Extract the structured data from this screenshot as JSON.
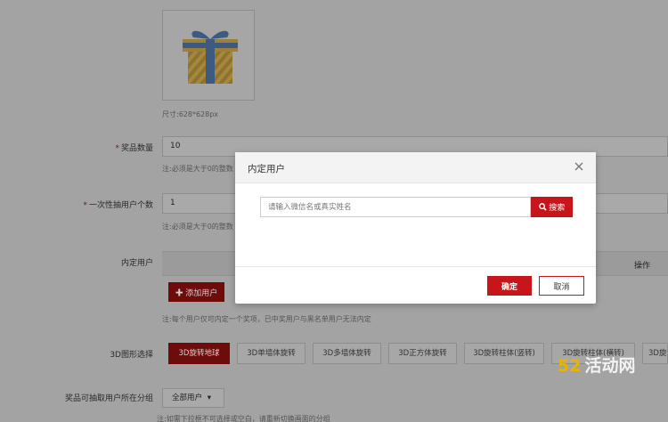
{
  "form": {
    "image_hint": "尺寸:628*628px",
    "prize_count": {
      "label": "奖品数量",
      "value": "10",
      "hint": "注:必须是大于0的整数"
    },
    "once_users": {
      "label": "一次性抽用户个数",
      "value": "1",
      "hint": "注:必须是大于0的整数"
    },
    "internal_users": {
      "label": "内定用户",
      "column_operation": "操作",
      "add_button": "添加用户",
      "hint": "注:每个用户仅可内定一个奖项，已中奖用户与黑名单用户无法内定"
    },
    "shape": {
      "label": "3D图形选择",
      "options": [
        "3D旋转地球",
        "3D单墙体旋转",
        "3D多墙体旋转",
        "3D正方体旋转",
        "3D旋转柱体(竖转)",
        "3D旋转柱体(横转)",
        "3D旋"
      ],
      "selected_index": 0
    },
    "group": {
      "label": "奖品可抽取用户所在分组",
      "value": "全部用户",
      "hint": "注:如需下拉框不可选择或空白，请重新切换画面的分组"
    }
  },
  "modal": {
    "title": "内定用户",
    "search_placeholder": "请输入微信名或真实姓名",
    "search_button": "搜索",
    "confirm_button": "确定",
    "cancel_button": "取消"
  },
  "watermark": {
    "number": "52",
    "text": "活动网"
  },
  "colors": {
    "accent": "#c7161b",
    "overlay": "#a3a3a3"
  }
}
